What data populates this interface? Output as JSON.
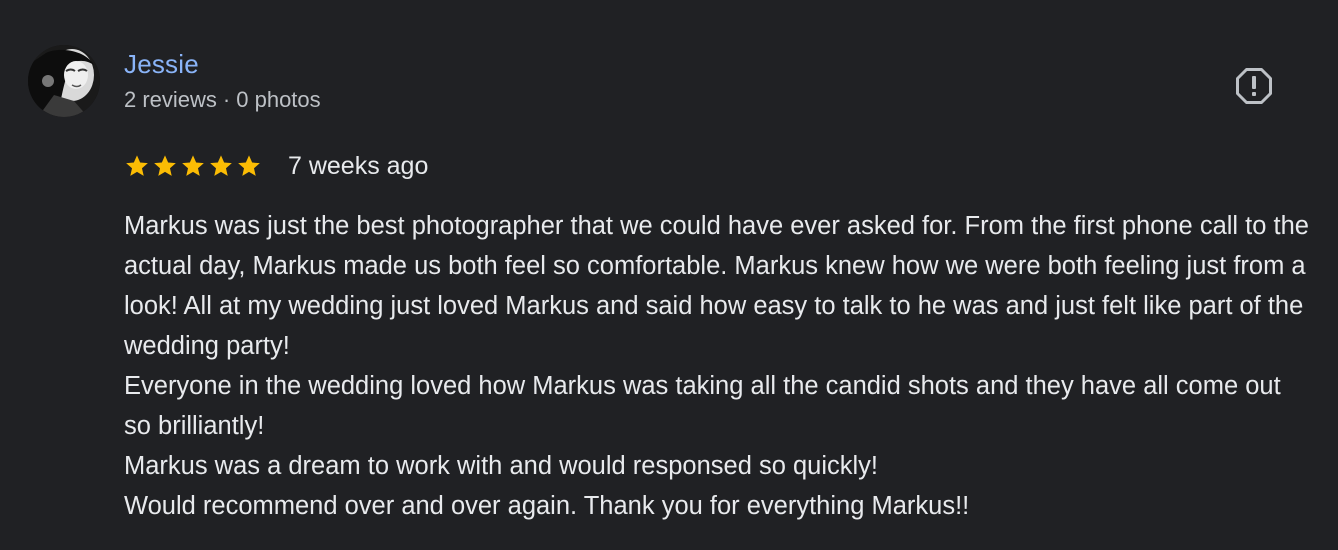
{
  "reviewer": {
    "name": "Jessie",
    "reviews_count": "2 reviews",
    "separator": "·",
    "photos_count": "0 photos"
  },
  "rating": {
    "stars": 5,
    "max": 5,
    "star_color": "#fbbc04",
    "date": "7 weeks ago"
  },
  "report": {
    "icon": "report-flag-icon"
  },
  "review_text": [
    "Markus was just the best photographer that we could have ever asked for. From the first phone call to the actual day, Markus made us both feel so comfortable. Markus knew how we were both feeling just from a look! All at my wedding just loved Markus and said how easy to talk to he was and just felt like part of the wedding party!",
    "Everyone in the wedding loved how Markus was taking all the candid shots and they have all come out so brilliantly!",
    "Markus was a dream to work with and would responsed so quickly!",
    "Would recommend over and over again. Thank you for everything Markus!!"
  ],
  "colors": {
    "background": "#202124",
    "name_link": "#8ab4f8",
    "text": "#e8eaed",
    "secondary_text": "#bdc1c6",
    "icon": "#bdc1c6"
  }
}
